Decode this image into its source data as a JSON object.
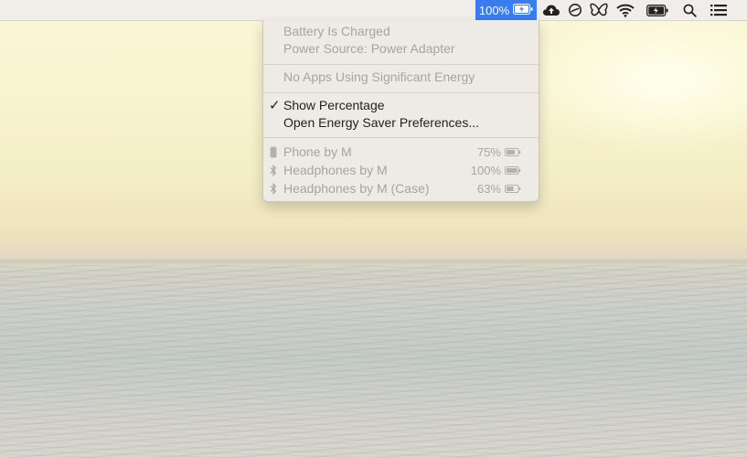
{
  "menubar": {
    "battery_percent": "100%",
    "icons": [
      "battery-charging-icon",
      "cloud-upload-icon",
      "focus-circle-icon",
      "butterfly-icon",
      "wifi-icon",
      "battery-charging-icon",
      "search-icon",
      "menu-list-icon"
    ],
    "highlight_color": "#3a7cf0"
  },
  "battery_menu": {
    "status_line1": "Battery Is Charged",
    "status_line2": "Power Source: Power Adapter",
    "energy_line": "No Apps Using Significant Energy",
    "show_percentage": "Show Percentage",
    "show_percentage_checked": true,
    "open_prefs": "Open Energy Saver Preferences...",
    "devices": [
      {
        "name": "Phone by M",
        "percent": "75%",
        "icon": "phone-icon"
      },
      {
        "name": "Headphones by M",
        "percent": "100%",
        "icon": "bluetooth-icon"
      },
      {
        "name": "Headphones by M (Case)",
        "percent": "63%",
        "icon": "bluetooth-icon"
      }
    ]
  }
}
